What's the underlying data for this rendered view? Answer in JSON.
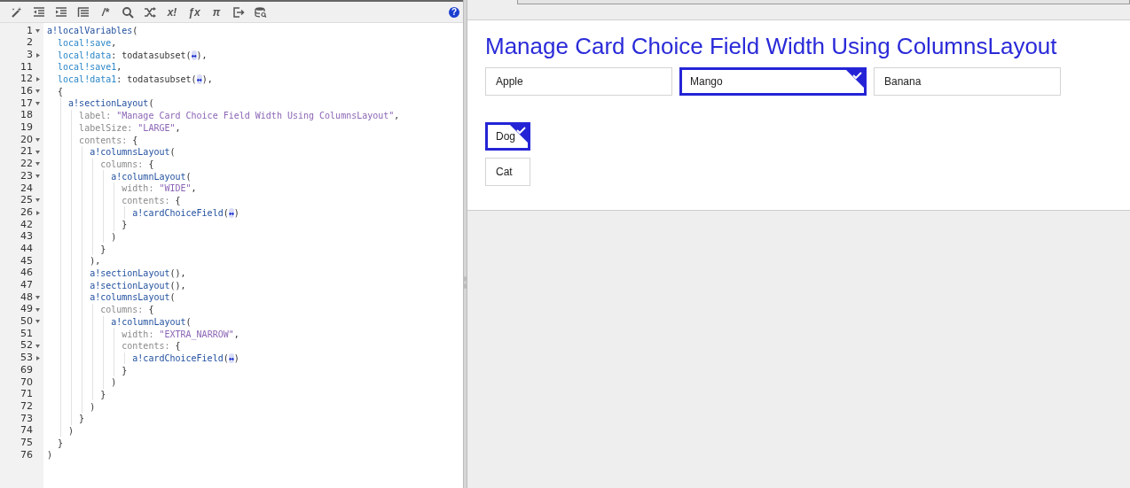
{
  "toolbar": [
    {
      "kind": "icon"
    },
    {
      "kind": "icon"
    },
    {
      "kind": "icon"
    },
    {
      "kind": "icon"
    },
    {
      "kind": "glyph",
      "text": "/*"
    },
    {
      "kind": "icon"
    },
    {
      "kind": "icon"
    },
    {
      "kind": "glyph",
      "text": "x!"
    },
    {
      "kind": "glyph",
      "text": "ƒx"
    },
    {
      "kind": "glyph",
      "text": "π"
    },
    {
      "kind": "icon"
    },
    {
      "kind": "icon"
    }
  ],
  "help": "?",
  "code_lines": [
    {
      "number": "1",
      "expanded": true,
      "segments": [
        {
          "kind": "fn",
          "text": "a!localVariables"
        },
        {
          "kind": "plain",
          "text": "("
        }
      ]
    },
    {
      "number": "2",
      "segments": [
        {
          "kind": "var",
          "text": "  local!save"
        },
        {
          "kind": "plain",
          "text": ","
        }
      ]
    },
    {
      "number": "3",
      "expanded": false,
      "segments": [
        {
          "kind": "var",
          "text": "  local!data"
        },
        {
          "kind": "plain",
          "text": ": todatasubset("
        },
        {
          "kind": "collapsed",
          "text": "↔"
        },
        {
          "kind": "plain",
          "text": "),"
        }
      ]
    },
    {
      "number": "11",
      "segments": [
        {
          "kind": "var",
          "text": "  local!save1"
        },
        {
          "kind": "plain",
          "text": ","
        }
      ]
    },
    {
      "number": "12",
      "expanded": false,
      "segments": [
        {
          "kind": "var",
          "text": "  local!data1"
        },
        {
          "kind": "plain",
          "text": ": todatasubset("
        },
        {
          "kind": "collapsed",
          "text": "↔"
        },
        {
          "kind": "plain",
          "text": "),"
        }
      ]
    },
    {
      "number": "16",
      "expanded": true,
      "segments": [
        {
          "kind": "plain",
          "text": "  {"
        }
      ]
    },
    {
      "number": "17",
      "expanded": true,
      "segments": [
        {
          "kind": "fn",
          "text": "    a!sectionLayout"
        },
        {
          "kind": "plain",
          "text": "("
        }
      ]
    },
    {
      "number": "18",
      "segments": [
        {
          "kind": "key",
          "text": "      label:"
        },
        {
          "kind": "str",
          "text": " \"Manage Card Choice Field Width Using ColumnsLayout\""
        },
        {
          "kind": "plain",
          "text": ","
        }
      ]
    },
    {
      "number": "19",
      "segments": [
        {
          "kind": "key",
          "text": "      labelSize:"
        },
        {
          "kind": "str",
          "text": " \"LARGE\""
        },
        {
          "kind": "plain",
          "text": ","
        }
      ]
    },
    {
      "number": "20",
      "expanded": true,
      "segments": [
        {
          "kind": "key",
          "text": "      contents:"
        },
        {
          "kind": "plain",
          "text": " {"
        }
      ]
    },
    {
      "number": "21",
      "expanded": true,
      "segments": [
        {
          "kind": "fn",
          "text": "        a!columnsLayout"
        },
        {
          "kind": "plain",
          "text": "("
        }
      ]
    },
    {
      "number": "22",
      "expanded": true,
      "segments": [
        {
          "kind": "key",
          "text": "          columns:"
        },
        {
          "kind": "plain",
          "text": " {"
        }
      ]
    },
    {
      "number": "23",
      "expanded": true,
      "segments": [
        {
          "kind": "fn",
          "text": "            a!columnLayout"
        },
        {
          "kind": "plain",
          "text": "("
        }
      ]
    },
    {
      "number": "24",
      "segments": [
        {
          "kind": "key",
          "text": "              width:"
        },
        {
          "kind": "str",
          "text": " \"WIDE\""
        },
        {
          "kind": "plain",
          "text": ","
        }
      ]
    },
    {
      "number": "25",
      "expanded": true,
      "segments": [
        {
          "kind": "key",
          "text": "              contents:"
        },
        {
          "kind": "plain",
          "text": " {"
        }
      ]
    },
    {
      "number": "26",
      "expanded": false,
      "segments": [
        {
          "kind": "fn",
          "text": "                a!cardChoiceField"
        },
        {
          "kind": "plain",
          "text": "("
        },
        {
          "kind": "collapsed",
          "text": "↔"
        },
        {
          "kind": "plain",
          "text": ")"
        }
      ]
    },
    {
      "number": "42",
      "segments": [
        {
          "kind": "plain",
          "text": "              }"
        }
      ]
    },
    {
      "number": "43",
      "segments": [
        {
          "kind": "plain",
          "text": "            )"
        }
      ]
    },
    {
      "number": "44",
      "segments": [
        {
          "kind": "plain",
          "text": "          }"
        }
      ]
    },
    {
      "number": "45",
      "segments": [
        {
          "kind": "plain",
          "text": "        ),"
        }
      ]
    },
    {
      "number": "46",
      "segments": [
        {
          "kind": "fn",
          "text": "        a!sectionLayout"
        },
        {
          "kind": "plain",
          "text": "(),"
        }
      ]
    },
    {
      "number": "47",
      "segments": [
        {
          "kind": "fn",
          "text": "        a!sectionLayout"
        },
        {
          "kind": "plain",
          "text": "(),"
        }
      ]
    },
    {
      "number": "48",
      "expanded": true,
      "segments": [
        {
          "kind": "fn",
          "text": "        a!columnsLayout"
        },
        {
          "kind": "plain",
          "text": "("
        }
      ]
    },
    {
      "number": "49",
      "expanded": true,
      "segments": [
        {
          "kind": "key",
          "text": "          columns:"
        },
        {
          "kind": "plain",
          "text": " {"
        }
      ]
    },
    {
      "number": "50",
      "expanded": true,
      "segments": [
        {
          "kind": "fn",
          "text": "            a!columnLayout"
        },
        {
          "kind": "plain",
          "text": "("
        }
      ]
    },
    {
      "number": "51",
      "segments": [
        {
          "kind": "key",
          "text": "              width:"
        },
        {
          "kind": "str",
          "text": " \"EXTRA_NARROW\""
        },
        {
          "kind": "plain",
          "text": ","
        }
      ]
    },
    {
      "number": "52",
      "expanded": true,
      "segments": [
        {
          "kind": "key",
          "text": "              contents:"
        },
        {
          "kind": "plain",
          "text": " {"
        }
      ]
    },
    {
      "number": "53",
      "expanded": false,
      "segments": [
        {
          "kind": "fn",
          "text": "                a!cardChoiceField"
        },
        {
          "kind": "plain",
          "text": "("
        },
        {
          "kind": "collapsed",
          "text": "↔"
        },
        {
          "kind": "plain",
          "text": ")"
        }
      ]
    },
    {
      "number": "69",
      "segments": [
        {
          "kind": "plain",
          "text": "              }"
        }
      ]
    },
    {
      "number": "70",
      "segments": [
        {
          "kind": "plain",
          "text": "            )"
        }
      ]
    },
    {
      "number": "71",
      "segments": [
        {
          "kind": "plain",
          "text": "          }"
        }
      ]
    },
    {
      "number": "72",
      "segments": [
        {
          "kind": "plain",
          "text": "        )"
        }
      ]
    },
    {
      "number": "73",
      "segments": [
        {
          "kind": "plain",
          "text": "      }"
        }
      ]
    },
    {
      "number": "74",
      "segments": [
        {
          "kind": "plain",
          "text": "    )"
        }
      ]
    },
    {
      "number": "75",
      "segments": [
        {
          "kind": "plain",
          "text": "  }"
        }
      ]
    },
    {
      "number": "76",
      "segments": [
        {
          "kind": "plain",
          "text": ")"
        }
      ]
    }
  ],
  "preview": {
    "title": "Manage Card Choice Field Width Using ColumnsLayout",
    "wide_cards": [
      {
        "label": "Apple",
        "selected": false
      },
      {
        "label": "Mango",
        "selected": true
      },
      {
        "label": "Banana",
        "selected": false
      }
    ],
    "narrow_cards": [
      {
        "label": "Dog",
        "selected": true
      },
      {
        "label": "Cat",
        "selected": false
      }
    ]
  }
}
